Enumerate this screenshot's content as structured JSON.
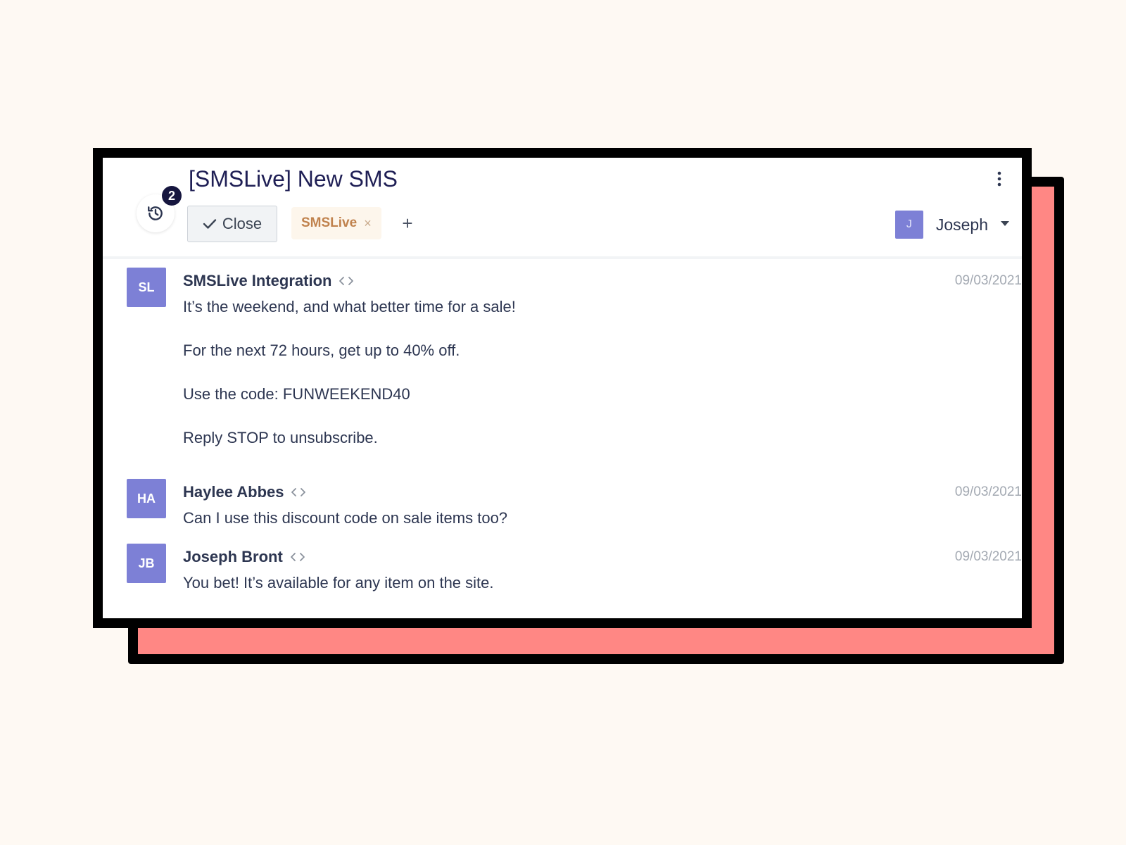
{
  "ticket": {
    "title": "[SMSLive] New SMS",
    "history_count": "2",
    "close_label": "Close",
    "tag": "SMSLive",
    "tag_remove": "×",
    "add_tag": "+",
    "assignee": {
      "initial": "J",
      "name": "Joseph"
    }
  },
  "messages": [
    {
      "initials": "SL",
      "sender": "SMSLive Integration",
      "date": "09/03/2021",
      "lines": [
        "It’s the weekend, and what better time for a sale!",
        "For the next 72 hours, get up to 40% off.",
        "Use the code: FUNWEEKEND40",
        "Reply STOP to unsubscribe."
      ]
    },
    {
      "initials": "HA",
      "sender": "Haylee Abbes",
      "date": "09/03/2021",
      "lines": [
        "Can I use this discount code on sale items too?"
      ]
    },
    {
      "initials": "JB",
      "sender": "Joseph Bront",
      "date": "09/03/2021",
      "lines": [
        "You bet! It’s available for any item on the site."
      ]
    }
  ],
  "colors": {
    "background": "#fef9f3",
    "shadow_card": "#ff8784",
    "avatar": "#7d80d6",
    "title": "#1f1f55",
    "tag_text": "#c0824d"
  },
  "icons": {
    "history": "history-clock-icon",
    "menu": "kebab-menu-icon",
    "check": "check-icon",
    "code": "code-brackets-icon",
    "dropdown": "caret-down-icon"
  }
}
